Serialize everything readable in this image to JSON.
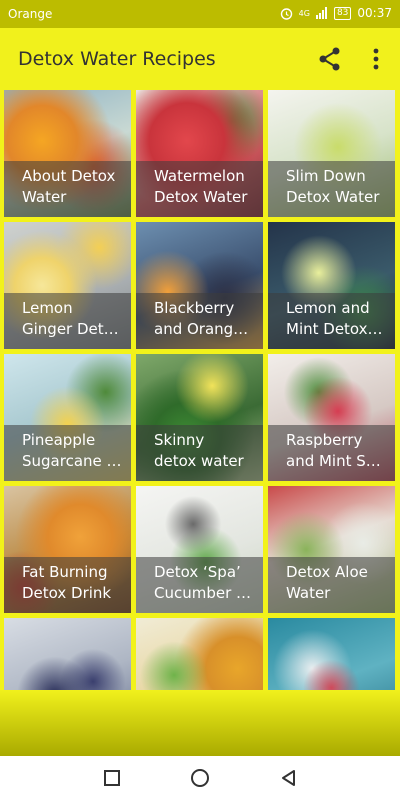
{
  "status_bar": {
    "carrier": "Orange",
    "network": "4G",
    "battery": "83",
    "time": "00:37"
  },
  "app_bar": {
    "title": "Detox Water Recipes",
    "share_icon": "share-icon",
    "more_icon": "more-vert-icon"
  },
  "recipes": [
    {
      "line1": "About Detox",
      "line2": "Water"
    },
    {
      "line1": "Watermelon",
      "line2": "Detox Water"
    },
    {
      "line1": "Slim Down",
      "line2": "Detox Water"
    },
    {
      "line1": "Lemon",
      "line2": "Ginger Det…"
    },
    {
      "line1": "Blackberry",
      "line2": "and Orang…"
    },
    {
      "line1": "Lemon and",
      "line2": "Mint Detox…"
    },
    {
      "line1": "Pineapple",
      "line2": "Sugarcane …"
    },
    {
      "line1": "Skinny",
      "line2": "detox water"
    },
    {
      "line1": "Raspberry",
      "line2": "and Mint S…"
    },
    {
      "line1": "Fat Burning",
      "line2": "Detox Drink"
    },
    {
      "line1": "Detox ‘Spa’",
      "line2": "Cucumber …"
    },
    {
      "line1": "Detox Aloe",
      "line2": "Water"
    }
  ],
  "nav_bar": {
    "recents_icon": "square-icon",
    "home_icon": "circle-icon",
    "back_icon": "triangle-back-icon"
  },
  "colors": {
    "app_bar": "#f1f11c",
    "status_bar": "#bcbc00"
  }
}
